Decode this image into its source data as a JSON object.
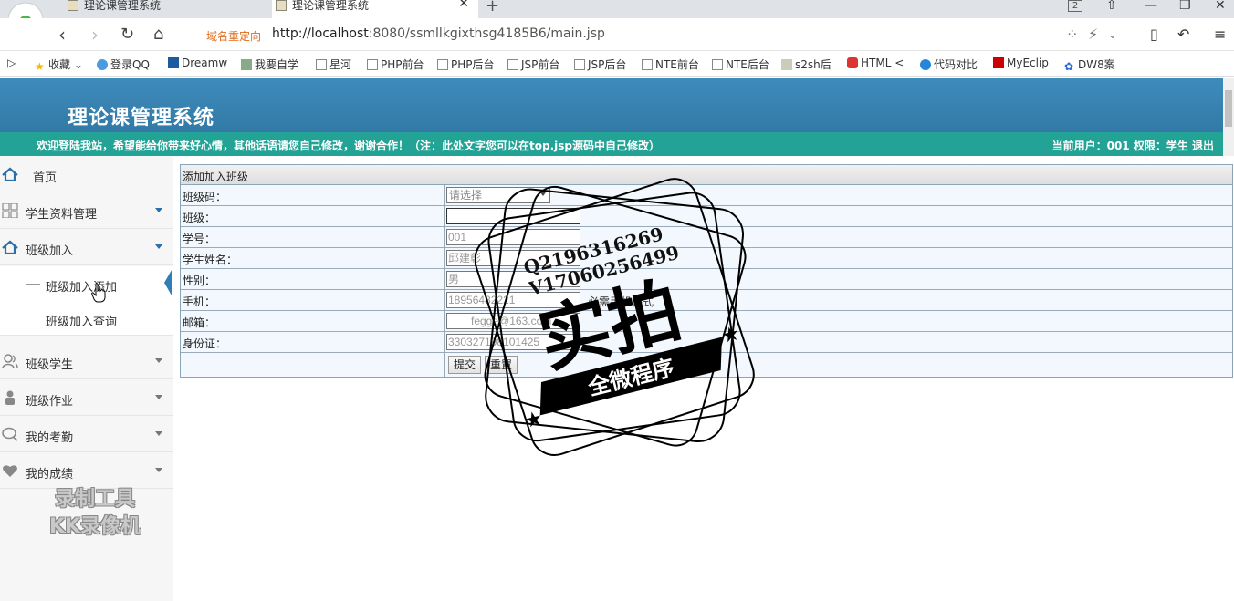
{
  "browser": {
    "tabs": [
      {
        "title": "理论课管理系统",
        "active": false
      },
      {
        "title": "理论课管理系统",
        "active": true
      }
    ],
    "tab_count": "2",
    "redirect_label": "域名重定向",
    "url_prefix": "http://localhost",
    "url_rest": ":8080/ssmllkgixthsg4185B6/main.jsp",
    "bookmarks": [
      "收藏",
      "登录QQ",
      "Dreamw",
      "我要自学",
      "星河",
      "PHP前台",
      "PHP后台",
      "JSP前台",
      "JSP后台",
      "NTE前台",
      "NTE后台",
      "s2sh后",
      "HTML <",
      "代码对比",
      "MyEclip",
      "DW8案"
    ]
  },
  "header": {
    "site_title": "理论课管理系统",
    "welcome": "欢迎登陆我站，希望能给你带来好心情，其他话语请您自己修改，谢谢合作！（注：此处文字您可以在top.jsp源码中自己修改）",
    "user_info": "当前用户：001 权限：学生 退出"
  },
  "sidebar": {
    "items": [
      {
        "label": "首页",
        "icon": "home-icon",
        "has_caret": false
      },
      {
        "label": "学生资料管理",
        "icon": "grid-icon",
        "has_caret": true
      },
      {
        "label": "班级加入",
        "icon": "home-icon",
        "has_caret": true
      },
      {
        "label": "班级学生",
        "icon": "users-icon",
        "has_caret": true
      },
      {
        "label": "班级作业",
        "icon": "user-icon",
        "has_caret": true
      },
      {
        "label": "我的考勤",
        "icon": "chat-icon",
        "has_caret": true
      },
      {
        "label": "我的成绩",
        "icon": "heart-icon",
        "has_caret": true
      }
    ],
    "sub_items": [
      "班级加入添加",
      "班级加入查询"
    ],
    "recorder_line1": "录制工具",
    "recorder_line2": "KK录像机"
  },
  "form": {
    "caption": "添加加入班级",
    "rows": [
      {
        "label": "班级码：",
        "type": "select",
        "value": "请选择"
      },
      {
        "label": "班级：",
        "type": "input",
        "value": ""
      },
      {
        "label": "学号：",
        "type": "input",
        "value": "001"
      },
      {
        "label": "学生姓名：",
        "type": "input",
        "value": "邱建彰"
      },
      {
        "label": "性别：",
        "type": "input",
        "value": "男"
      },
      {
        "label": "手机：",
        "type": "input",
        "value": "18956482221",
        "hint": "必需手机格式"
      },
      {
        "label": "邮箱：",
        "type": "input",
        "value": "fegge@163.com"
      },
      {
        "label": "身份证：",
        "type": "input",
        "value": "330327198101425"
      }
    ],
    "submit_label": "提交",
    "reset_label": "重置"
  },
  "watermark": {
    "line1": "Q2196316269",
    "line2": "V17060256499",
    "main": "实拍",
    "banner": "全微程序"
  },
  "colors": {
    "header_blue": "#3b87b6",
    "welcome_teal": "#22a396",
    "form_bg": "#f2f8fd",
    "active_marker": "#2f7fb5"
  }
}
